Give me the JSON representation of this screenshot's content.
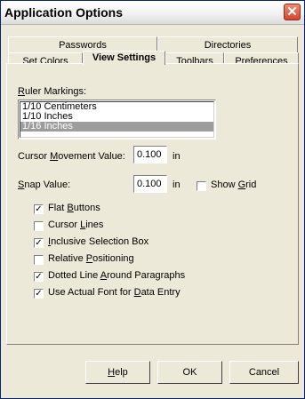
{
  "window": {
    "title": "Application Options",
    "close_glyph": "✕"
  },
  "tabs": {
    "back": [
      "Passwords",
      "Directories"
    ],
    "front": [
      "Set Colors",
      "View Settings",
      "Toolbars",
      "Preferences"
    ],
    "active": "View Settings"
  },
  "ruler": {
    "label_prefix": "R",
    "label_rest": "uler Markings:",
    "options": [
      "1/10 Centimeters",
      "1/10 Inches",
      "1/16 Inches"
    ],
    "selected": "1/16 Inches"
  },
  "cursor": {
    "label_a": "Cursor ",
    "label_u": "M",
    "label_b": "ovement Value:",
    "value": "0.100",
    "unit": "in"
  },
  "snap": {
    "label_u": "S",
    "label_b": "nap Value:",
    "value": "0.100",
    "unit": "in",
    "show_grid_a": "Show ",
    "show_grid_u": "G",
    "show_grid_b": "rid",
    "show_grid_checked": false
  },
  "checkboxes": [
    {
      "a": "Flat ",
      "u": "B",
      "b": "uttons",
      "checked": true
    },
    {
      "a": "Cursor ",
      "u": "L",
      "b": "ines",
      "checked": false
    },
    {
      "a": "",
      "u": "I",
      "b": "nclusive Selection Box",
      "checked": true
    },
    {
      "a": "Relative ",
      "u": "P",
      "b": "ositioning",
      "checked": false
    },
    {
      "a": "Dotted Line ",
      "u": "A",
      "b": "round Paragraphs",
      "checked": true
    },
    {
      "a": "Use Actual Font for ",
      "u": "D",
      "b": "ata Entry",
      "checked": true
    }
  ],
  "buttons": {
    "help_u": "H",
    "help_b": "elp",
    "ok": "OK",
    "cancel": "Cancel"
  }
}
